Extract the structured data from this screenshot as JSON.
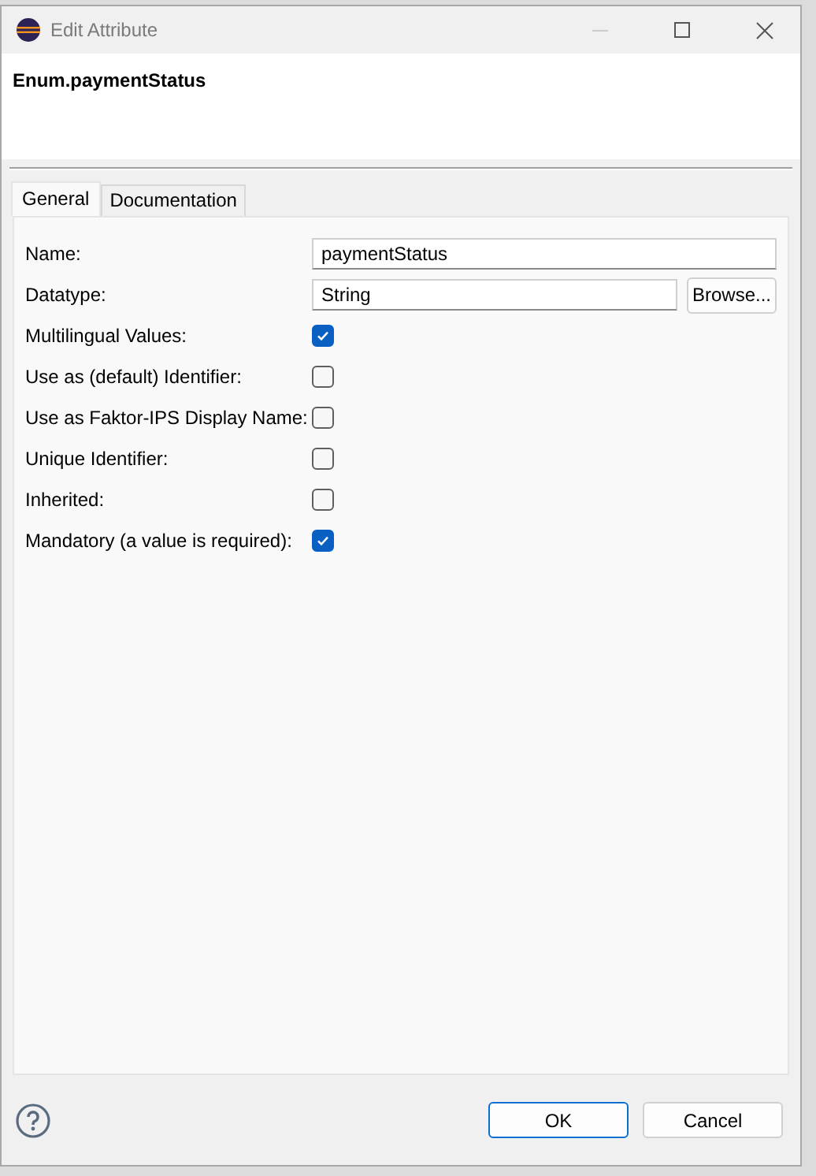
{
  "window": {
    "title": "Edit Attribute"
  },
  "header": {
    "title": "Enum.paymentStatus"
  },
  "tabs": [
    {
      "label": "General",
      "selected": true
    },
    {
      "label": "Documentation",
      "selected": false
    }
  ],
  "fields": [
    {
      "label": "Name:",
      "value": "paymentStatus"
    },
    {
      "label": "Datatype:",
      "value": "String",
      "button": "Browse..."
    }
  ],
  "options": [
    {
      "label": "Multilingual Values:",
      "checked": true
    },
    {
      "label": "Use as (default) Identifier:",
      "checked": false
    },
    {
      "label": "Use as Faktor-IPS Display Name:",
      "checked": false
    },
    {
      "label": "Unique Identifier:",
      "checked": false
    },
    {
      "label": "Inherited:",
      "checked": false
    },
    {
      "label": "Mandatory (a value is required):",
      "checked": true
    }
  ],
  "buttons": [
    {
      "label": "OK",
      "default": true
    },
    {
      "label": "Cancel",
      "default": false
    }
  ]
}
